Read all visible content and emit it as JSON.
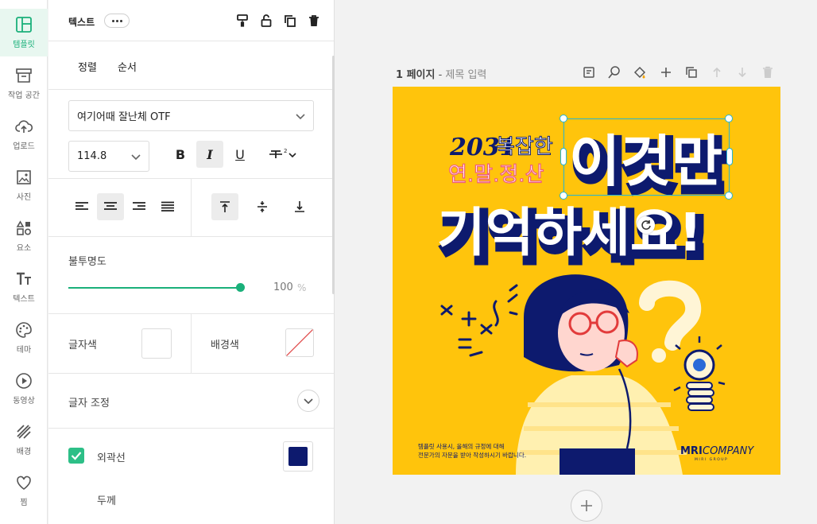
{
  "rail": [
    {
      "label": "템플릿",
      "icon": "layout-icon",
      "active": true
    },
    {
      "label": "작업 공간",
      "icon": "archive-icon"
    },
    {
      "label": "업로드",
      "icon": "cloud-upload-icon"
    },
    {
      "label": "사진",
      "icon": "image-icon"
    },
    {
      "label": "요소",
      "icon": "shapes-icon"
    },
    {
      "label": "텍스트",
      "icon": "text-icon"
    },
    {
      "label": "테마",
      "icon": "palette-icon"
    },
    {
      "label": "동영상",
      "icon": "play-icon"
    },
    {
      "label": "배경",
      "icon": "pattern-icon"
    },
    {
      "label": "찜",
      "icon": "heart-icon"
    }
  ],
  "panel": {
    "title": "텍스트",
    "tabs": [
      "정렬",
      "순서"
    ],
    "font_family": "여기어때 잘난체 OTF",
    "font_size": "114.8",
    "bold_label": "B",
    "italic_label": "I",
    "underline_label": "U",
    "opacity_label": "불투명도",
    "opacity_value": "100",
    "opacity_unit": "%",
    "opacity_fraction": 1.0,
    "text_color_label": "글자색",
    "bg_color_label": "배경색",
    "text_adjust_label": "글자 조정",
    "outline_label": "외곽선",
    "outline_checked": true,
    "outline_color": "#0d1a6e",
    "thickness_label": "두께"
  },
  "canvas": {
    "page_number": "1 페이지",
    "separator": " - ",
    "page_title_placeholder": "제목 입력",
    "accent_color": "#ffc40c"
  },
  "design": {
    "line1_a": "2031",
    "line1_b": "복잡한",
    "line2": "연.말.정.산",
    "big1": "이것만",
    "big2": "기억하세요!",
    "footer_line1": "템플릿 사용시, 올해의 규정에 대해",
    "footer_line2": "전문가의 자문을 받아 작성하시기 바랍니다.",
    "brand": "COMPANY",
    "brand_mark": "MRI",
    "brand_sub": "MIRI GROUP"
  }
}
